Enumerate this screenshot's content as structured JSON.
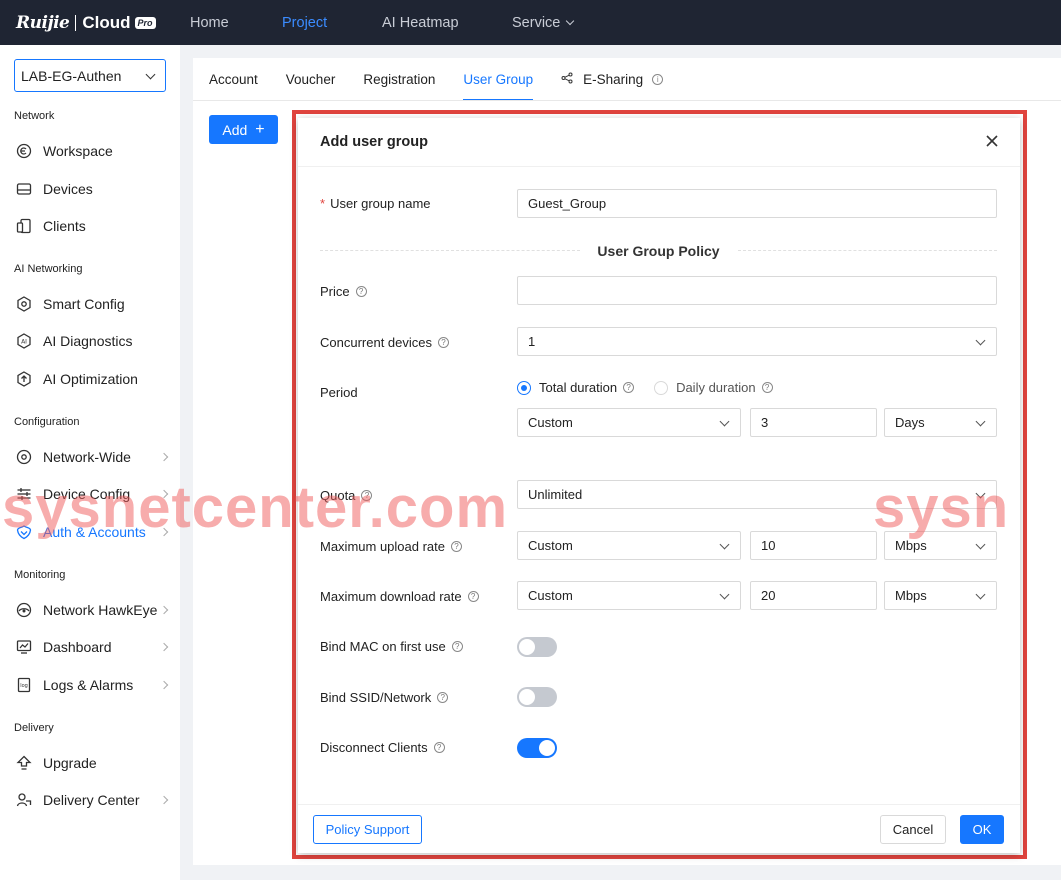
{
  "brand": {
    "name": "Ruijie",
    "product": "Cloud",
    "badge": "Pro"
  },
  "topnav": {
    "home": "Home",
    "project": "Project",
    "heatmap": "AI Heatmap",
    "service": "Service"
  },
  "sidebar": {
    "project": "LAB-EG-Authen",
    "sections": {
      "network": "Network",
      "ai": "AI Networking",
      "config": "Configuration",
      "monitoring": "Monitoring",
      "delivery": "Delivery"
    },
    "items": {
      "workspace": "Workspace",
      "devices": "Devices",
      "clients": "Clients",
      "smart_config": "Smart Config",
      "ai_diagnostics": "AI Diagnostics",
      "ai_optimization": "AI Optimization",
      "network_wide": "Network-Wide",
      "device_config": "Device Config",
      "auth_accounts": "Auth & Accounts",
      "hawkeye": "Network HawkEye",
      "dashboard": "Dashboard",
      "logs": "Logs & Alarms",
      "upgrade": "Upgrade",
      "delivery_center": "Delivery Center"
    }
  },
  "tabs": {
    "account": "Account",
    "voucher": "Voucher",
    "registration": "Registration",
    "user_group": "User Group",
    "esharing": "E-Sharing"
  },
  "add_button": "Add",
  "modal": {
    "title": "Add user group",
    "group_name_label": "User group name",
    "group_name_value": "Guest_Group",
    "section_title": "User Group Policy",
    "price_label": "Price",
    "price_value": "",
    "concurrent_label": "Concurrent devices",
    "concurrent_value": "1",
    "period_label": "Period",
    "period_total": "Total duration",
    "period_daily": "Daily duration",
    "period_mode": "Custom",
    "period_amount": "3",
    "period_unit": "Days",
    "quota_label": "Quota",
    "quota_value": "Unlimited",
    "upload_label": "Maximum upload rate",
    "upload_mode": "Custom",
    "upload_value": "10",
    "upload_unit": "Mbps",
    "download_label": "Maximum download rate",
    "download_mode": "Custom",
    "download_value": "20",
    "download_unit": "Mbps",
    "bind_mac_label": "Bind MAC on first use",
    "bind_ssid_label": "Bind SSID/Network",
    "disconnect_label": "Disconnect Clients",
    "policy_support": "Policy Support",
    "cancel": "Cancel",
    "ok": "OK"
  },
  "watermark": {
    "left": "sysnetcenter.com",
    "right": "sysn"
  },
  "colors": {
    "accent": "#1677ff",
    "topbar": "#1f2533",
    "highlight": "#e0443e"
  }
}
